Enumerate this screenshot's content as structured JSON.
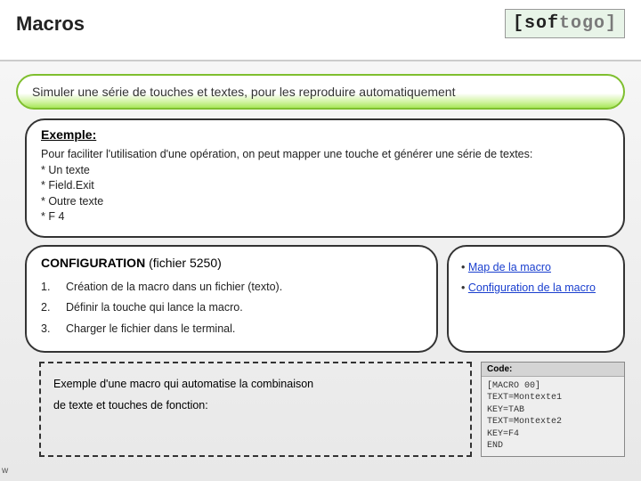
{
  "header": {
    "title": "Macros",
    "logo_dark": "[sof",
    "logo_light": "togo]"
  },
  "subtitle": "Simuler une série de touches et textes, pour les reproduire automatiquement",
  "example": {
    "title": "Exemple:",
    "intro": "Pour faciliter l'utilisation d'une opération, on peut mapper une touche et générer une série de textes:",
    "items": [
      "* Un texte",
      "* Field.Exit",
      "* Outre texte",
      "* F 4"
    ]
  },
  "config": {
    "title_bold": "CONFIGURATION",
    "title_rest": " (fichier 5250)",
    "steps": [
      {
        "n": "1.",
        "t": "Création de la macro dans un fichier (texto)."
      },
      {
        "n": "2.",
        "t": "Définir la touche qui lance la macro."
      },
      {
        "n": "3.",
        "t": "Charger le fichier dans le terminal."
      }
    ]
  },
  "links": {
    "l1": "Map de la macro",
    "l2": "Configuration de la macro"
  },
  "code_desc": {
    "line1": "Exemple d'une macro qui automatise la combinaison",
    "line2": "de texte et touches de fonction:"
  },
  "code": {
    "bar": "Code:",
    "body": "[MACRO 00]\nTEXT=Montexte1\nKEY=TAB\nTEXT=Montexte2\nKEY=F4\nEND"
  },
  "footer": "w"
}
